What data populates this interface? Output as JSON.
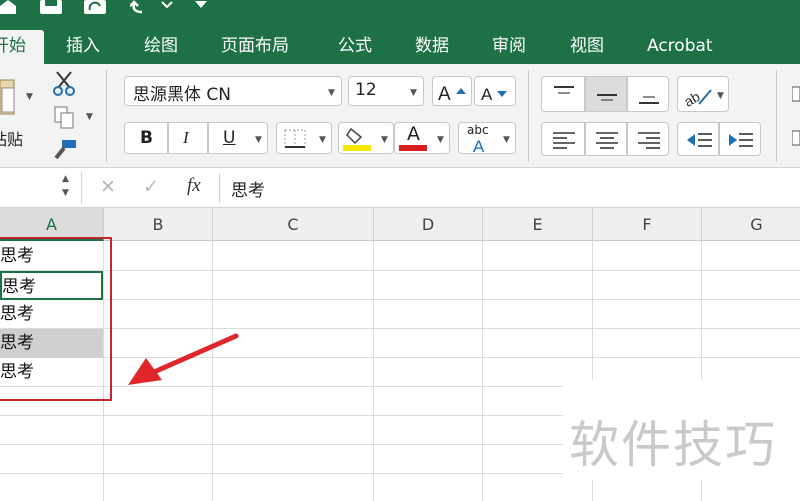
{
  "tabs": [
    {
      "label": "开始",
      "active": true
    },
    {
      "label": "插入"
    },
    {
      "label": "绘图"
    },
    {
      "label": "页面布局"
    },
    {
      "label": "公式"
    },
    {
      "label": "数据"
    },
    {
      "label": "审阅"
    },
    {
      "label": "视图"
    },
    {
      "label": "Acrobat"
    }
  ],
  "ribbon": {
    "paste_label": "粘贴",
    "font_name": "思源黑体 CN",
    "font_size": "12",
    "bold": "B",
    "italic": "I",
    "underline": "U",
    "wrap_sample": "abc",
    "font_color_letter": "A",
    "highlight_color": "#f5e600",
    "font_color": "#d81e1e"
  },
  "formula_bar": {
    "cancel": "✕",
    "confirm": "✓",
    "fx": "fx",
    "content": "思考"
  },
  "columns": [
    "A",
    "B",
    "C",
    "D",
    "E",
    "F",
    "G"
  ],
  "cells": [
    "思考",
    "思考",
    "思考",
    "思考",
    "思考"
  ],
  "watermark": "软件技巧",
  "colors": {
    "accent": "#1e7145",
    "highlight_border": "#c0282d",
    "arrow": "#e0262b"
  }
}
